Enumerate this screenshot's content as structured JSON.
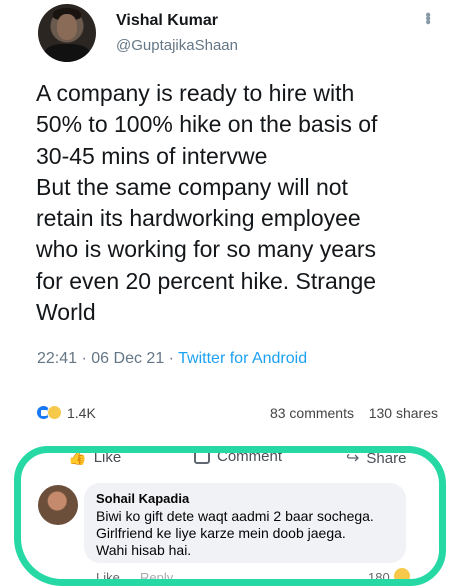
{
  "tweet": {
    "author_name": "Vishal Kumar",
    "author_handle": "@GuptajikaShaan",
    "more_icon": "more-vertical-icon",
    "text_lines": [
      "A company is ready to hire with",
      "50% to 100% hike on the basis of",
      "30-45 mins of intervwe",
      "But the same company will not",
      "retain its hardworking employee",
      "who is working for so many years",
      "for even 20 percent hike. Strange",
      "World"
    ],
    "time": "22:41",
    "date": "06 Dec 21",
    "source": "Twitter for Android",
    "separator": "·"
  },
  "facebook_post": {
    "reaction_count": "1.4K",
    "comments": "83 comments",
    "shares": "130 shares",
    "actions": {
      "like": "Like",
      "comment": "Comment",
      "share": "Share"
    }
  },
  "comment": {
    "author": "Sohail Kapadia",
    "text_lines": [
      "Biwi ko gift dete waqt aadmi 2 baar sochega.",
      "Girlfriend ke liye karze mein doob jaega.",
      "Wahi hisab hai."
    ],
    "like_label": "Like",
    "reply_label": "Reply",
    "reaction_count": "180"
  },
  "colors": {
    "highlight": "#26d9a4",
    "link": "#1da1f2",
    "secondary_text": "#657786",
    "bubble": "#f0f2f5"
  }
}
